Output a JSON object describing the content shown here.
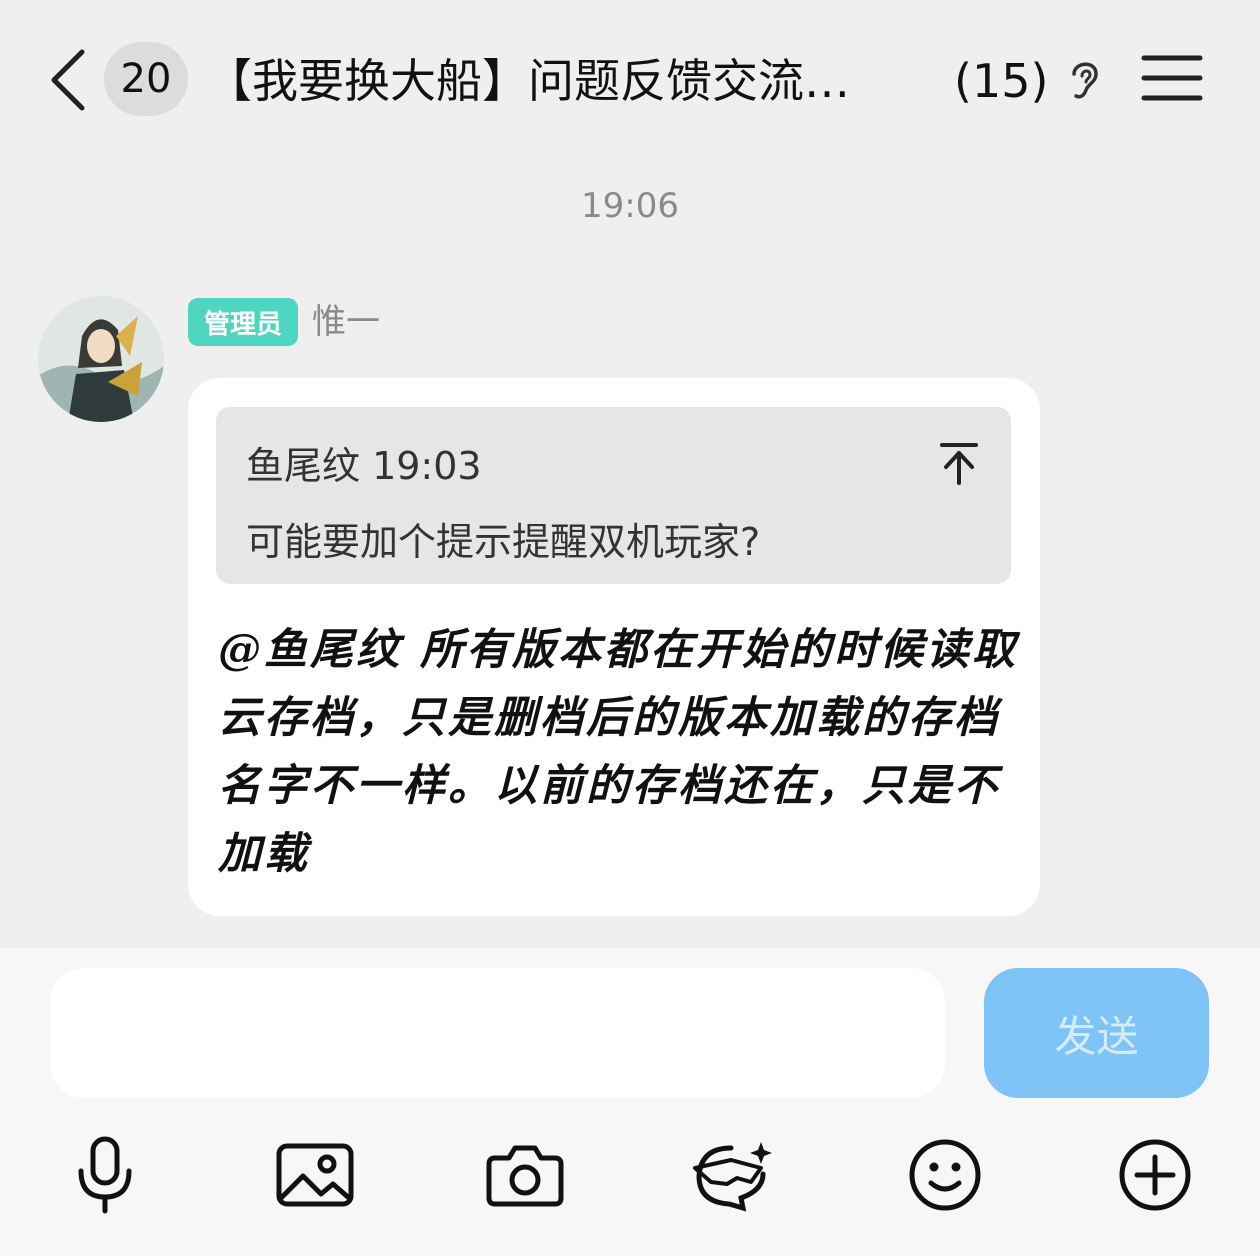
{
  "header": {
    "unread_count": "20",
    "title": "【我要换大船】问题反馈交流…",
    "member_count": "(15)"
  },
  "timestamp": "19:06",
  "message": {
    "role_badge": "管理员",
    "sender": "惟一",
    "quote": {
      "author_time": "鱼尾纹 19:03",
      "text": "可能要加个提示提醒双机玩家?"
    },
    "text": "@鱼尾纹 所有版本都在开始的时候读取云存档，只是删档后的版本加载的存档名字不一样。以前的存档还在，只是不加载"
  },
  "composer": {
    "input_value": "",
    "send_label": "发送"
  },
  "colors": {
    "background": "#efefef",
    "role_badge": "#4ed6c0",
    "send_button": "#7ec4f6"
  },
  "toolbar_icons": [
    "microphone-icon",
    "image-icon",
    "camera-icon",
    "sticker-icon",
    "emoji-icon",
    "plus-icon"
  ]
}
